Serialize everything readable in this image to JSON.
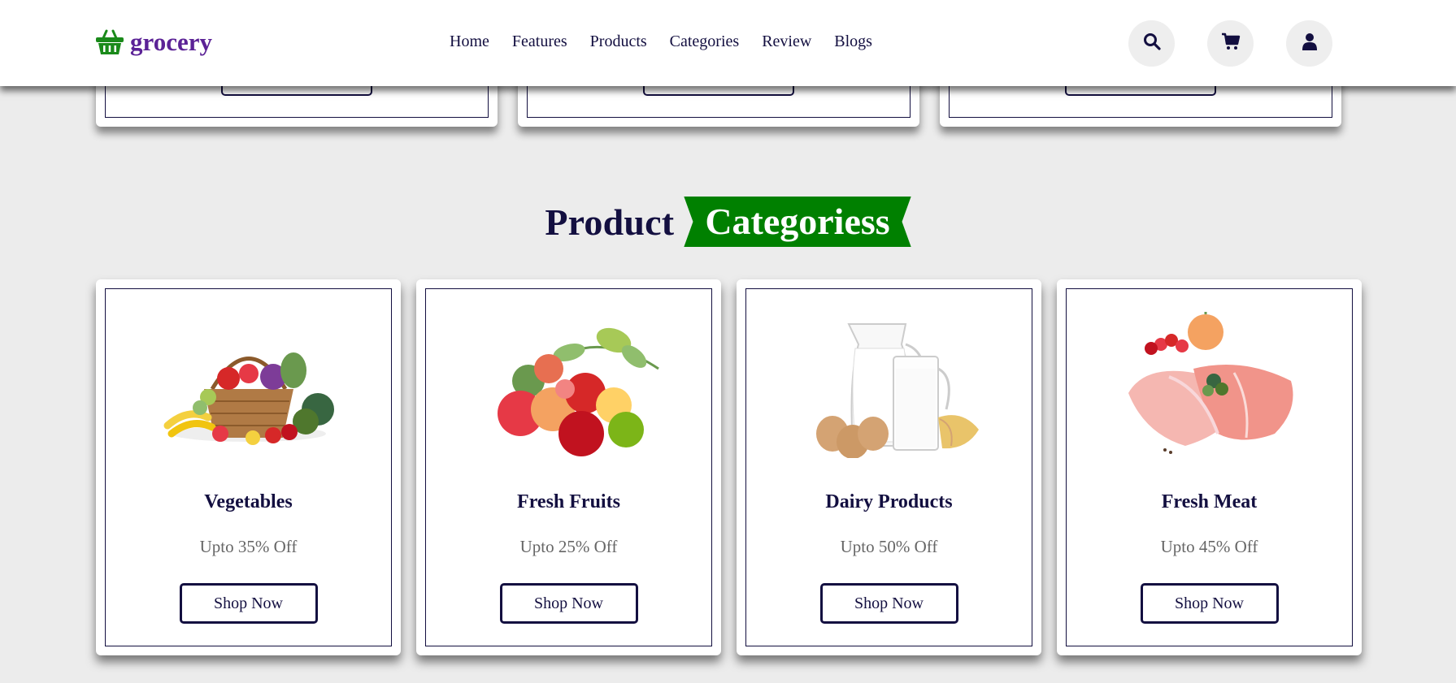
{
  "brand": {
    "name": "grocery",
    "logo_icon": "shopping-basket-icon",
    "color": "#5b2296",
    "icon_color": "#1a8a1a"
  },
  "nav": {
    "items": [
      {
        "label": "Home"
      },
      {
        "label": "Features"
      },
      {
        "label": "Products"
      },
      {
        "label": "Categories"
      },
      {
        "label": "Review"
      },
      {
        "label": "Blogs"
      }
    ]
  },
  "header_icons": [
    {
      "icon": "search-icon"
    },
    {
      "icon": "shopping-cart-icon"
    },
    {
      "icon": "user-icon"
    }
  ],
  "section": {
    "title_plain": "Product",
    "title_highlight": "Categoriess",
    "highlight_color": "#008000"
  },
  "categories": [
    {
      "name": "Vegetables",
      "discount": "Upto 35% Off",
      "button": "Shop Now",
      "image": "vegetable-basket-image"
    },
    {
      "name": "Fresh Fruits",
      "discount": "Upto 25% Off",
      "button": "Shop Now",
      "image": "fresh-fruits-image"
    },
    {
      "name": "Dairy Products",
      "discount": "Upto 50% Off",
      "button": "Shop Now",
      "image": "dairy-products-image"
    },
    {
      "name": "Fresh Meat",
      "discount": "Upto 45% Off",
      "button": "Shop Now",
      "image": "fresh-meat-image"
    }
  ],
  "colors": {
    "text_dark": "#130f40",
    "page_bg": "#ececec",
    "muted_text": "#666666"
  }
}
